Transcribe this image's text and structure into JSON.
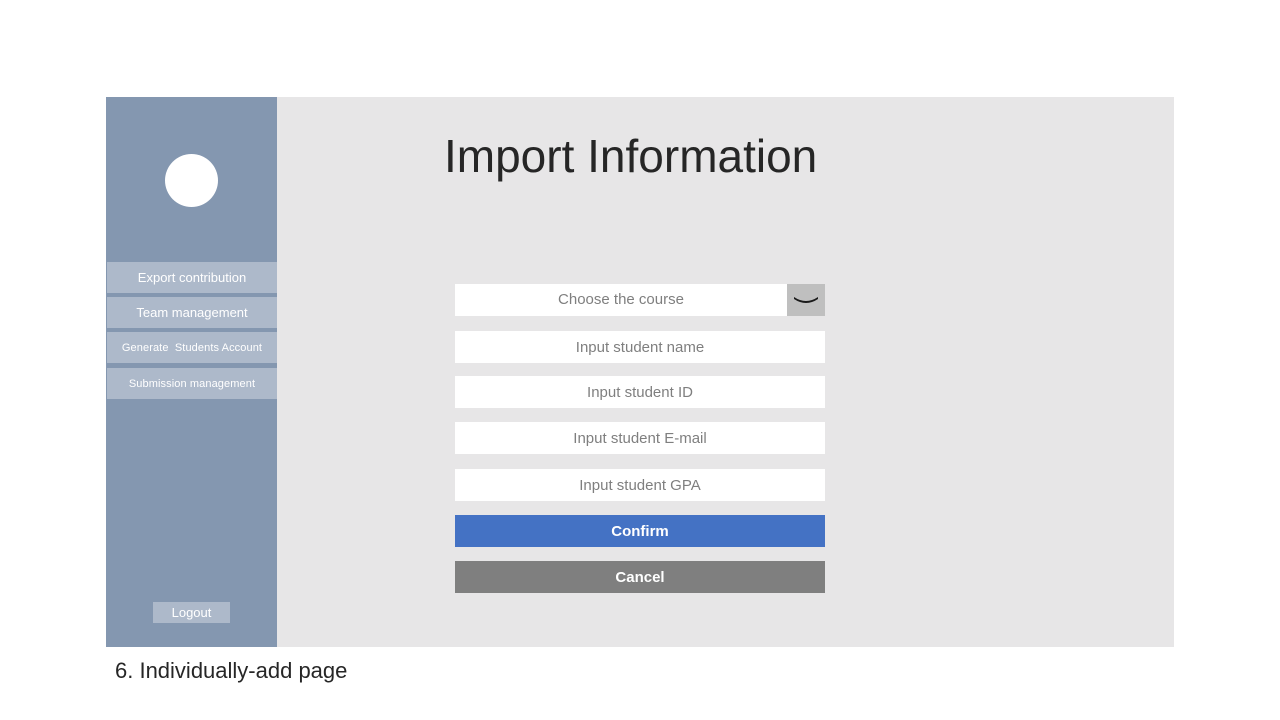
{
  "sidebar": {
    "items": [
      {
        "label": "Export contribution"
      },
      {
        "label": "Team management"
      },
      {
        "label": "Generate  Students Account"
      },
      {
        "label": "Submission management"
      }
    ],
    "logout_label": "Logout"
  },
  "main": {
    "title": "Import Information",
    "course_select": {
      "placeholder": "Choose the course",
      "icon": "chevron-down-icon"
    },
    "fields": {
      "name_placeholder": "Input student name",
      "id_placeholder": "Input student ID",
      "email_placeholder": "Input student E-mail",
      "gpa_placeholder": "Input student GPA"
    },
    "confirm_label": "Confirm",
    "cancel_label": "Cancel"
  },
  "caption": "6. Individually-add page",
  "colors": {
    "sidebar_bg": "#8497b0",
    "nav_item_bg": "#adb9ca",
    "content_bg": "#e7e6e7",
    "confirm_bg": "#4472c4",
    "cancel_bg": "#7f7f7f"
  }
}
